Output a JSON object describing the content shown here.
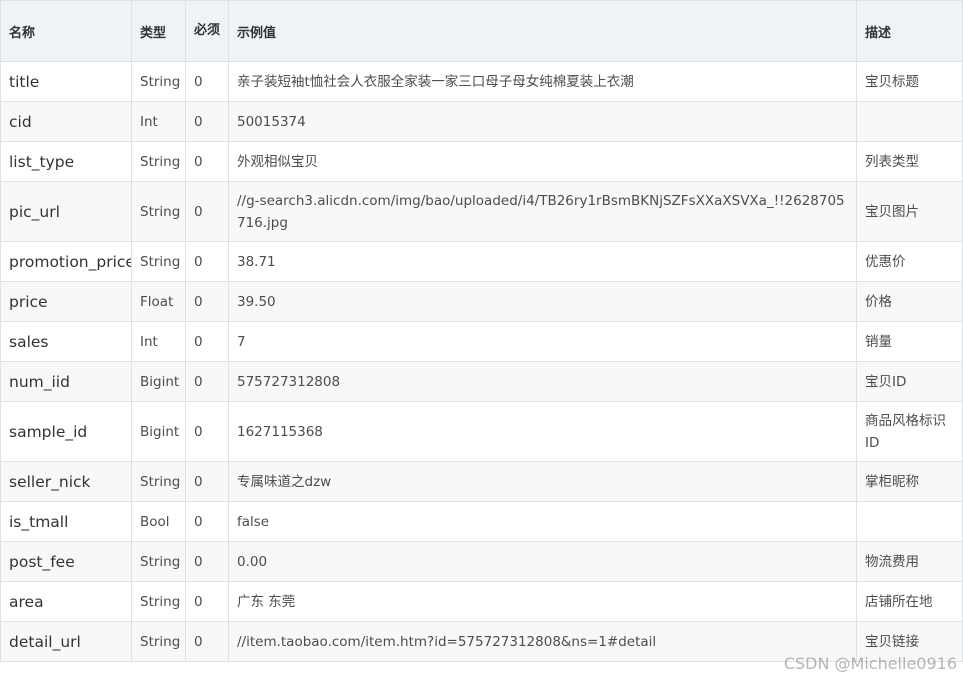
{
  "header": {
    "name": "名称",
    "type": "类型",
    "required": "必须",
    "example": "示例值",
    "description": "描述"
  },
  "rows": [
    {
      "name": "title",
      "type": "String",
      "required": "0",
      "example": "亲子装短袖t恤社会人衣服全家装一家三口母子母女纯棉夏装上衣潮",
      "description": "宝贝标题"
    },
    {
      "name": "cid",
      "type": "Int",
      "required": "0",
      "example": "50015374",
      "description": ""
    },
    {
      "name": "list_type",
      "type": "String",
      "required": "0",
      "example": "外观相似宝贝",
      "description": "列表类型"
    },
    {
      "name": "pic_url",
      "type": "String",
      "required": "0",
      "example": "//g-search3.alicdn.com/img/bao/uploaded/i4/TB26ry1rBsmBKNjSZFsXXaXSVXa_!!2628705716.jpg",
      "description": "宝贝图片"
    },
    {
      "name": "promotion_price",
      "type": "String",
      "required": "0",
      "example": "38.71",
      "description": "优惠价"
    },
    {
      "name": "price",
      "type": "Float",
      "required": "0",
      "example": "39.50",
      "description": "价格"
    },
    {
      "name": "sales",
      "type": "Int",
      "required": "0",
      "example": "7",
      "description": "销量"
    },
    {
      "name": "num_iid",
      "type": "Bigint",
      "required": "0",
      "example": "575727312808",
      "description": "宝贝ID"
    },
    {
      "name": "sample_id",
      "type": "Bigint",
      "required": "0",
      "example": "1627115368",
      "description": "商品风格标识ID"
    },
    {
      "name": "seller_nick",
      "type": "String",
      "required": "0",
      "example": "专属味道之dzw",
      "description": "掌柜昵称"
    },
    {
      "name": "is_tmall",
      "type": "Bool",
      "required": "0",
      "example": "false",
      "description": ""
    },
    {
      "name": "post_fee",
      "type": "String",
      "required": "0",
      "example": "0.00",
      "description": "物流费用"
    },
    {
      "name": "area",
      "type": "String",
      "required": "0",
      "example": "广东 东莞",
      "description": "店铺所在地"
    },
    {
      "name": "detail_url",
      "type": "String",
      "required": "0",
      "example": "//item.taobao.com/item.htm?id=575727312808&ns=1#detail",
      "description": "宝贝链接"
    }
  ],
  "watermark": "CSDN @Michelle0916"
}
